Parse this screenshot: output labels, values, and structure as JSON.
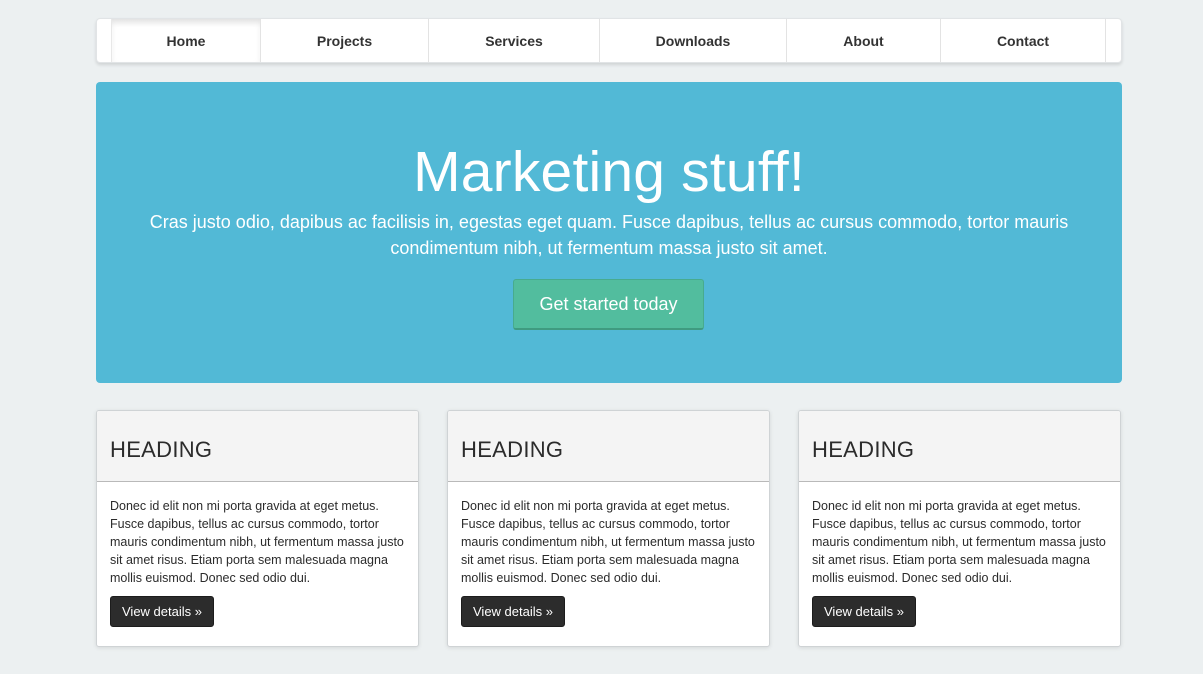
{
  "nav": {
    "items": [
      {
        "label": "Home",
        "active": true
      },
      {
        "label": "Projects",
        "active": false
      },
      {
        "label": "Services",
        "active": false
      },
      {
        "label": "Downloads",
        "active": false
      },
      {
        "label": "About",
        "active": false
      },
      {
        "label": "Contact",
        "active": false
      }
    ]
  },
  "hero": {
    "title": "Marketing stuff!",
    "text": "Cras justo odio, dapibus ac facilisis in, egestas eget quam. Fusce dapibus, tellus ac cursus commodo, tortor mauris condimentum nibh, ut fermentum massa justo sit amet.",
    "cta_label": "Get started today",
    "background_color": "#52b9d6",
    "cta_color": "#52bd9e"
  },
  "cards": [
    {
      "heading": "HEADING",
      "body": "Donec id elit non mi porta gravida at eget metus. Fusce dapibus, tellus ac cursus commodo, tortor mauris condimentum nibh, ut fermentum massa justo sit amet risus. Etiam porta sem malesuada magna mollis euismod. Donec sed odio dui.",
      "button_label": "View details »"
    },
    {
      "heading": "HEADING",
      "body": "Donec id elit non mi porta gravida at eget metus. Fusce dapibus, tellus ac cursus commodo, tortor mauris condimentum nibh, ut fermentum massa justo sit amet risus. Etiam porta sem malesuada magna mollis euismod. Donec sed odio dui.",
      "button_label": "View details »"
    },
    {
      "heading": "HEADING",
      "body": "Donec id elit non mi porta gravida at eget metus. Fusce dapibus, tellus ac cursus commodo, tortor mauris condimentum nibh, ut fermentum massa justo sit amet risus. Etiam porta sem malesuada magna mollis euismod. Donec sed odio dui.",
      "button_label": "View details »"
    }
  ]
}
